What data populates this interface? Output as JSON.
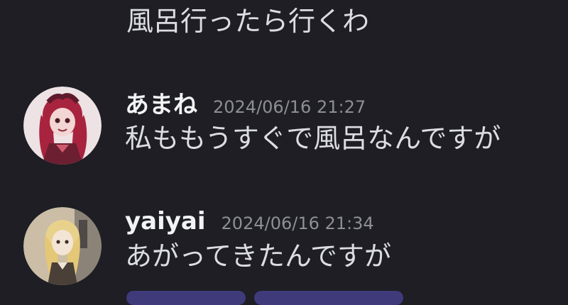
{
  "conversation": {
    "top_message": {
      "text": "風呂行ったら行くわ"
    },
    "messages": [
      {
        "author": "あまね",
        "timestamp": "2024/06/16 21:27",
        "text": "私ももうすぐで風呂なんですが",
        "avatar_icon": "avatar-red-hair-girl-icon"
      },
      {
        "author": "yaiyai",
        "timestamp": "2024/06/16 21:34",
        "text": "あがってきたんですが",
        "avatar_icon": "avatar-blonde-photo-icon"
      }
    ]
  },
  "theme": {
    "background": "#1e1e24",
    "text": "#dcdde2",
    "author": "#f2f3f5",
    "timestamp": "#8d8f96",
    "button_strip": "#3f3b7a"
  }
}
